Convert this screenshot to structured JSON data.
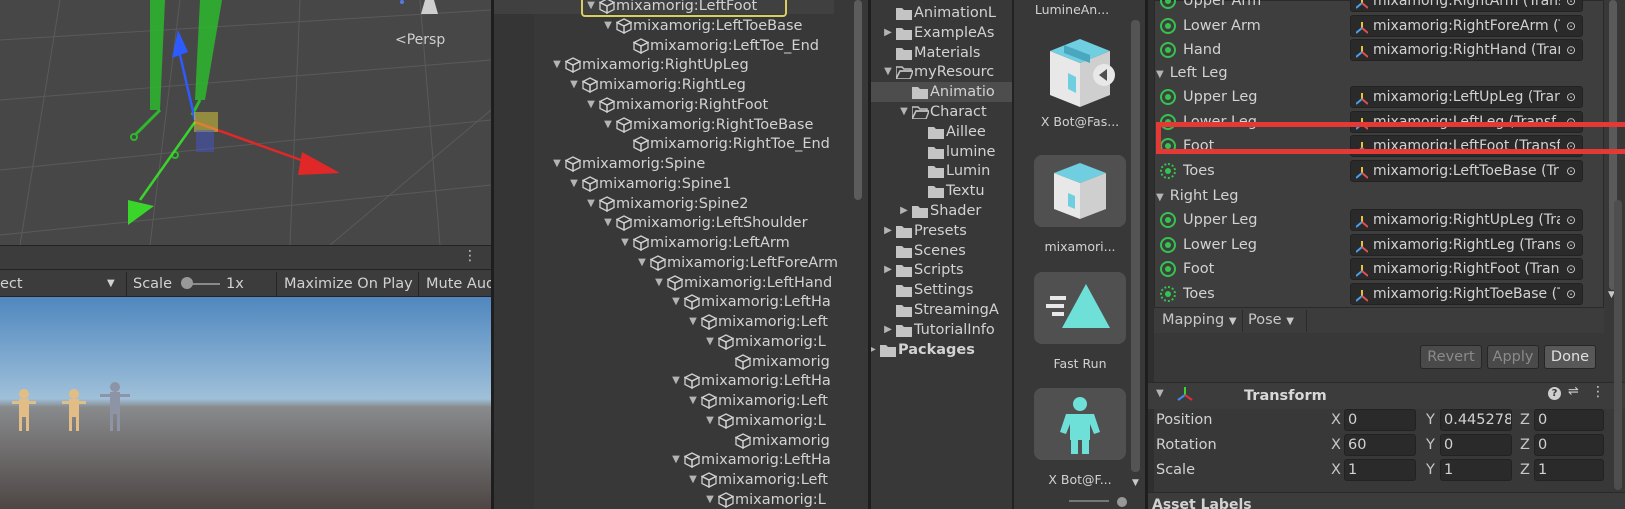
{
  "scene": {
    "persp_label": "<Persp"
  },
  "game_toolbar": {
    "display_partial": "ect",
    "scale_label": "Scale",
    "scale_value": "1x",
    "maximize_label": "Maximize On Play",
    "mute_label": "Mute Aud"
  },
  "hierarchy": {
    "items": [
      {
        "label": "mixamorig:LeftFoot",
        "depth": 4,
        "fold": "down",
        "selected": true
      },
      {
        "label": "mixamorig:LeftToeBase",
        "depth": 5,
        "fold": "down"
      },
      {
        "label": "mixamorig:LeftToe_End",
        "depth": 6,
        "fold": "none"
      },
      {
        "label": "mixamorig:RightUpLeg",
        "depth": 2,
        "fold": "down"
      },
      {
        "label": "mixamorig:RightLeg",
        "depth": 3,
        "fold": "down"
      },
      {
        "label": "mixamorig:RightFoot",
        "depth": 4,
        "fold": "down"
      },
      {
        "label": "mixamorig:RightToeBase",
        "depth": 5,
        "fold": "down"
      },
      {
        "label": "mixamorig:RightToe_End",
        "depth": 6,
        "fold": "none"
      },
      {
        "label": "mixamorig:Spine",
        "depth": 2,
        "fold": "down"
      },
      {
        "label": "mixamorig:Spine1",
        "depth": 3,
        "fold": "down"
      },
      {
        "label": "mixamorig:Spine2",
        "depth": 4,
        "fold": "down"
      },
      {
        "label": "mixamorig:LeftShoulder",
        "depth": 5,
        "fold": "down"
      },
      {
        "label": "mixamorig:LeftArm",
        "depth": 6,
        "fold": "down"
      },
      {
        "label": "mixamorig:LeftForeArm",
        "depth": 7,
        "fold": "down"
      },
      {
        "label": "mixamorig:LeftHand",
        "depth": 8,
        "fold": "down"
      },
      {
        "label": "mixamorig:LeftHa",
        "depth": 9,
        "fold": "down"
      },
      {
        "label": "mixamorig:Left",
        "depth": 10,
        "fold": "down"
      },
      {
        "label": "mixamorig:L",
        "depth": 11,
        "fold": "down"
      },
      {
        "label": "mixamorig",
        "depth": 12,
        "fold": "none"
      },
      {
        "label": "mixamorig:LeftHa",
        "depth": 9,
        "fold": "down"
      },
      {
        "label": "mixamorig:Left",
        "depth": 10,
        "fold": "down"
      },
      {
        "label": "mixamorig:L",
        "depth": 11,
        "fold": "down"
      },
      {
        "label": "mixamorig",
        "depth": 12,
        "fold": "none"
      },
      {
        "label": "mixamorig:LeftHa",
        "depth": 9,
        "fold": "down"
      },
      {
        "label": "mixamorig:Left",
        "depth": 10,
        "fold": "down"
      },
      {
        "label": "mixamorig:L",
        "depth": 11,
        "fold": "down"
      }
    ]
  },
  "project_tree": {
    "items": [
      {
        "label": "AnimationL",
        "depth": 1,
        "fold": "none",
        "bold": false
      },
      {
        "label": "ExampleAs",
        "depth": 1,
        "fold": "right",
        "bold": false
      },
      {
        "label": "Materials",
        "depth": 1,
        "fold": "none",
        "bold": false
      },
      {
        "label": "myResourc",
        "depth": 1,
        "fold": "down",
        "bold": false,
        "open": true
      },
      {
        "label": "Animatio",
        "depth": 2,
        "fold": "none",
        "bold": false,
        "highlight": true
      },
      {
        "label": "Charact",
        "depth": 2,
        "fold": "down",
        "bold": false,
        "open": true
      },
      {
        "label": "Aillee",
        "depth": 3,
        "fold": "none",
        "bold": false
      },
      {
        "label": "lumine",
        "depth": 3,
        "fold": "none",
        "bold": false
      },
      {
        "label": "Lumin",
        "depth": 3,
        "fold": "none",
        "bold": false
      },
      {
        "label": "Textu",
        "depth": 3,
        "fold": "none",
        "bold": false
      },
      {
        "label": "Shader",
        "depth": 2,
        "fold": "right",
        "bold": false
      },
      {
        "label": "Presets",
        "depth": 1,
        "fold": "right",
        "bold": false
      },
      {
        "label": "Scenes",
        "depth": 1,
        "fold": "none",
        "bold": false
      },
      {
        "label": "Scripts",
        "depth": 1,
        "fold": "right",
        "bold": false
      },
      {
        "label": "Settings",
        "depth": 1,
        "fold": "none",
        "bold": false
      },
      {
        "label": "StreamingA",
        "depth": 1,
        "fold": "none",
        "bold": false
      },
      {
        "label": "TutorialInfo",
        "depth": 1,
        "fold": "right",
        "bold": false
      },
      {
        "label": "Packages",
        "depth": 0,
        "fold": "right",
        "bold": true
      }
    ]
  },
  "project_grid": {
    "top_label": "LumineAn...",
    "items": [
      {
        "label": "X Bot@Fas...",
        "icon": "model-prefab-icon"
      },
      {
        "label": "mixamori...",
        "icon": "avatar-mask-icon"
      },
      {
        "label": "Fast Run",
        "icon": "animation-clip-icon"
      },
      {
        "label": "X Bot@F...",
        "icon": "avatar-icon"
      }
    ]
  },
  "inspector": {
    "top_rows": [
      {
        "label": "Upper Arm",
        "value": "mixamorig:RightArm (Trans"
      },
      {
        "label": "Lower Arm",
        "value": "mixamorig:RightForeArm (T"
      },
      {
        "label": "Hand",
        "value": "mixamorig:RightHand (Trar"
      }
    ],
    "left_leg_header": "Left Leg",
    "left_leg_rows": [
      {
        "label": "Upper Leg",
        "value": "mixamorig:LeftUpLeg (Trar",
        "dashed": false
      },
      {
        "label": "Lower Leg",
        "value": "mixamorig:LeftLeg (Transf",
        "dashed": false
      },
      {
        "label": "Foot",
        "value": "mixamorig:LeftFoot (Transf",
        "dashed": false,
        "selected": true
      },
      {
        "label": "Toes",
        "value": "mixamorig:LeftToeBase (Tr",
        "dashed": true
      }
    ],
    "right_leg_header": "Right Leg",
    "right_leg_rows": [
      {
        "label": "Upper Leg",
        "value": "mixamorig:RightUpLeg (Tra",
        "dashed": false
      },
      {
        "label": "Lower Leg",
        "value": "mixamorig:RightLeg (Trans",
        "dashed": false
      },
      {
        "label": "Foot",
        "value": "mixamorig:RightFoot (Trans",
        "dashed": false
      },
      {
        "label": "Toes",
        "value": "mixamorig:RightToeBase (T",
        "dashed": true
      }
    ],
    "mapping_label": "Mapping",
    "pose_label": "Pose",
    "revert_label": "Revert",
    "apply_label": "Apply",
    "done_label": "Done",
    "transform_title": "Transform",
    "position_label": "Position",
    "rotation_label": "Rotation",
    "scale_label": "Scale",
    "axis_x": "X",
    "axis_y": "Y",
    "axis_z": "Z",
    "position": {
      "x": "0",
      "y": "0.445278",
      "z": "0"
    },
    "rotation": {
      "x": "60",
      "y": "0",
      "z": "0"
    },
    "scale": {
      "x": "1",
      "y": "1",
      "z": "1"
    },
    "asset_labels": "Asset Labels"
  },
  "colors": {
    "highlight_box": "#e53935",
    "humanoid_green": "#36c24e",
    "selection_yellow": "#d8cf60"
  }
}
